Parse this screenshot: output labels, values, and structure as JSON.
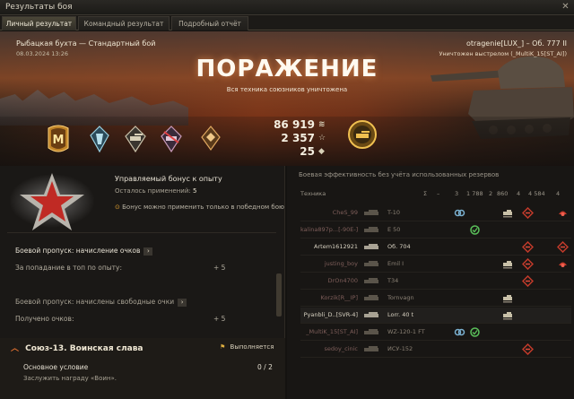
{
  "window": {
    "title": "Результаты боя",
    "close_glyph": "✕"
  },
  "tabs": [
    {
      "label": "Личный результат",
      "active": true
    },
    {
      "label": "Командный результат",
      "active": false
    },
    {
      "label": "Подробный отчёт",
      "active": false
    }
  ],
  "header": {
    "map": "Рыбацкая бухта — Стандартный бой",
    "datetime": "08.03.2024 13:26",
    "player": "otragenie[LUX_] – Об. 777 II",
    "killed_by": "Уничтожен выстрелом (_MultiK_15[ST_AI])",
    "result": "ПОРАЖЕНИЕ",
    "result_sub": "Вся техника союзников уничтожена"
  },
  "medals": [
    {
      "icon": "mastery-badge-m-icon",
      "letter": "M"
    },
    {
      "icon": "achievement-shield-icon"
    },
    {
      "icon": "achievement-tank-icon-1"
    },
    {
      "icon": "achievement-tank-icon-2"
    },
    {
      "icon": "achievement-rank-icon"
    },
    {
      "icon": "marksman-tank-medal-icon"
    }
  ],
  "totals": {
    "credits": "86 919",
    "credits_icon": "credits-icon",
    "xp": "2 357",
    "xp_icon": "☆",
    "extra": "25",
    "extra_icon": "bond-icon"
  },
  "bonus": {
    "title": "Управляемый бонус к опыту",
    "uses_label": "Осталось применений:",
    "uses_value": "5",
    "note": "Бонус можно применить только в победном бою",
    "note_icon": "⊙"
  },
  "battle_pass": {
    "section1": "Боевой пропуск: начисление очков",
    "row1_label": "За попадание в топ по опыту:",
    "row1_value": "+ 5",
    "section2": "Боевой пропуск: начислены свободные очки",
    "row2_label": "Получено очков:",
    "row2_value": "+ 5",
    "arrow": "›"
  },
  "mission": {
    "chevron": "︿",
    "title": "Союз-13. Воинская слава",
    "status_icon": "⚑",
    "status": "Выполняется",
    "condition": "Основное условие",
    "progress": "0 / 2",
    "description": "Заслужить награду «Воин»."
  },
  "team": {
    "title": "Боевая эффективность без учёта использованных резервов",
    "header_label": "Техника",
    "columns": [
      "Σ",
      "–",
      "3",
      "1 788",
      "2",
      "860",
      "4",
      "4 584",
      "4"
    ],
    "rows": [
      {
        "player": "CheS_99",
        "tank": "T-10",
        "alive": false,
        "me": false,
        "icons": [
          "spot",
          "",
          "",
          "hit-vehicle",
          "kill-red",
          "",
          "kill-red2"
        ]
      },
      {
        "player": "kalina897p...[-90E-]",
        "tank": "E 50",
        "alive": false,
        "me": false,
        "icons": [
          "",
          "assist-green",
          "",
          "",
          "",
          "",
          ""
        ]
      },
      {
        "player": "Artem1612921",
        "tank": "Об. 704",
        "alive": true,
        "me": false,
        "icons": [
          "",
          "",
          "",
          "",
          "kill-red",
          "",
          "kill-red"
        ]
      },
      {
        "player": "justing_boy",
        "tank": "Emil I",
        "alive": false,
        "me": false,
        "icons": [
          "",
          "",
          "",
          "hit-vehicle",
          "kill-red",
          "",
          "kill-red2"
        ]
      },
      {
        "player": "DrOn4700",
        "tank": "T34",
        "alive": false,
        "me": false,
        "icons": [
          "",
          "",
          "",
          "",
          "kill-red",
          "",
          ""
        ]
      },
      {
        "player": "Korzik[R__IP]",
        "tank": "Tornvagn",
        "alive": false,
        "me": false,
        "icons": [
          "",
          "",
          "",
          "hit-vehicle",
          "",
          "",
          ""
        ]
      },
      {
        "player": "Pyanbli_D..[SVR-4]",
        "tank": "Lorr. 40 t",
        "alive": true,
        "me": true,
        "icons": [
          "",
          "",
          "",
          "hit-vehicle",
          "",
          "",
          ""
        ]
      },
      {
        "player": "_MultiK_15[ST_AI]",
        "tank": "WZ-120-1 FT",
        "alive": false,
        "me": false,
        "icons": [
          "spot",
          "assist-green",
          "",
          "",
          "",
          "",
          ""
        ]
      },
      {
        "player": "sedoy_cinic",
        "tank": "ИСУ-152",
        "alive": false,
        "me": false,
        "icons": [
          "",
          "",
          "",
          "",
          "kill-red",
          "",
          ""
        ]
      }
    ]
  },
  "colors": {
    "accent_orange": "#e07030",
    "gold": "#d8a83a",
    "dead_name": "#7e5e5a",
    "alive_name": "#d8d2c2",
    "kill_red": "#c23a2a",
    "assist_green": "#5ac05a",
    "spot_blue": "#7ab0d0"
  }
}
